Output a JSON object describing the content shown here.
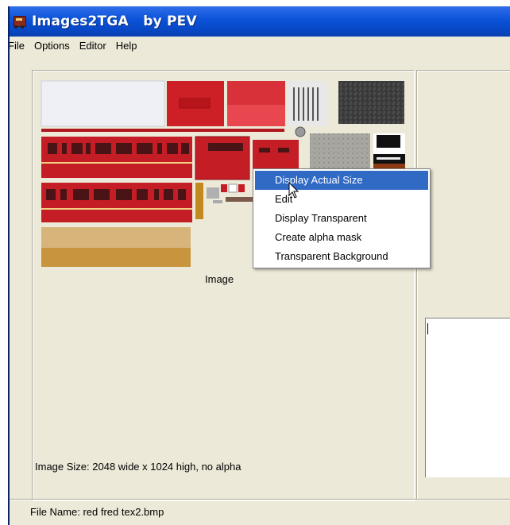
{
  "window": {
    "title": "Images2TGA   by PEV",
    "app_icon": "train-icon"
  },
  "menu": {
    "items": [
      "File",
      "Options",
      "Editor",
      "Help"
    ]
  },
  "image_panel": {
    "caption": "Image",
    "size_text": "Image Size: 2048 wide x 1024 high, no alpha"
  },
  "status": {
    "file_name": "File Name:  red fred tex2.bmp"
  },
  "context_menu": {
    "items": [
      "Display Actual Size",
      "Edit",
      "Display Transparent",
      "Create alpha mask",
      "Transparent Background"
    ],
    "selected_index": 0
  },
  "colors": {
    "title_blue": "#0a52d8",
    "window_face": "#ece9d8",
    "highlight": "#316ac5",
    "train_red": "#c8202a"
  }
}
